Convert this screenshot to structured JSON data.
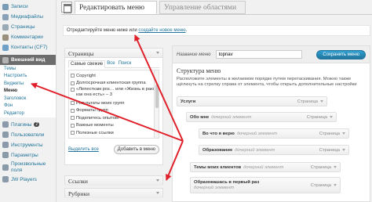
{
  "sidebar": {
    "items": [
      {
        "label": "Записи",
        "icon": "pushpin-icon",
        "color": "#7a9bb5"
      },
      {
        "label": "Медиафайлы",
        "icon": "media-icon",
        "color": "#8aa2b8"
      },
      {
        "label": "Страницы",
        "icon": "page-icon",
        "color": "#9aa9b6"
      },
      {
        "label": "Комментарии",
        "icon": "comment-icon",
        "color": "#9a8f7c"
      },
      {
        "label": "Контакты (CF7)",
        "icon": "contact-icon",
        "color": "#6ea0c8"
      }
    ],
    "appearance": {
      "label": "Внешний вид",
      "icon": "appearance-icon",
      "color": "#b3b3b3"
    },
    "appearance_sub": [
      "Темы",
      "Настроить",
      "Виджеты",
      "Меню",
      "Заголовок",
      "Фон",
      "Редактор"
    ],
    "bottom_items": [
      {
        "label": "Плагины",
        "badge": "2",
        "icon": "plugin-icon",
        "color": "#8a9aa8"
      },
      {
        "label": "Пользователи",
        "icon": "users-icon",
        "color": "#8a9aa8"
      },
      {
        "label": "Инструменты",
        "icon": "tools-icon",
        "color": "#8a9aa8"
      },
      {
        "label": "Параметры",
        "icon": "settings-icon",
        "color": "#8a9aa8"
      },
      {
        "label": "Произвольные поля",
        "icon": "fields-icon",
        "color": "#8a9aa8"
      },
      {
        "label": "JW Players",
        "icon": "player-icon",
        "color": "#8a9aa8"
      }
    ]
  },
  "tabs": {
    "edit": "Редактировать меню",
    "locations": "Управление областями"
  },
  "info": {
    "text": "Отредактируйте меню ниже или ",
    "link": "создайте новое меню",
    "end": "."
  },
  "pages_panel": {
    "title": "Страницы",
    "tabs": [
      "Самые свежие",
      "Все",
      "Поиск"
    ],
    "items": [
      "Copyright",
      "Долгосрочная клиентская группа",
      "«Лепесткам роз… или «Жизнь в раю как она есть» – 3",
      "Результаты моих групп",
      "Форматы групп",
      "Поделитесь опытом",
      "Важные моменты",
      "Полезные ссылки"
    ],
    "select_all": "Выделить все",
    "add_button": "Добавить в меню"
  },
  "links_panel": {
    "title": "Ссылки"
  },
  "headings_panel": {
    "title": "Рубрики"
  },
  "menu": {
    "name_label": "Название меню",
    "name_value": "topnav",
    "save_button": "Сохранить меню",
    "structure_title": "Структура меню",
    "structure_desc": "Расположите элементы в желаемом порядке путем перетаскивания. Можно также щёлкнуть на стрелку справа от элемента, чтобы открыть дополнительные настройки",
    "items": [
      {
        "title": "Услуги",
        "sub": "",
        "type": "Страница"
      },
      {
        "title": "Обо мне",
        "sub": "дочерний элемент",
        "type": "Страница"
      },
      {
        "title": "Во что я верю",
        "sub": "дочерний элемент",
        "type": "Страница"
      },
      {
        "title": "Образование",
        "sub": "дочерний элемент",
        "type": "Страница"
      },
      {
        "title": "Темы моих клиентов",
        "sub": "дочерний элемент",
        "type": "Страница"
      },
      {
        "title": "Образовашась в первый раз",
        "sub": "дочерний элемент",
        "type": "Страница"
      }
    ]
  },
  "colors": {
    "link": "#21759b",
    "annotation": "#e0202a",
    "active_menu": "#6d6d6d",
    "save_button": "#21759b"
  }
}
